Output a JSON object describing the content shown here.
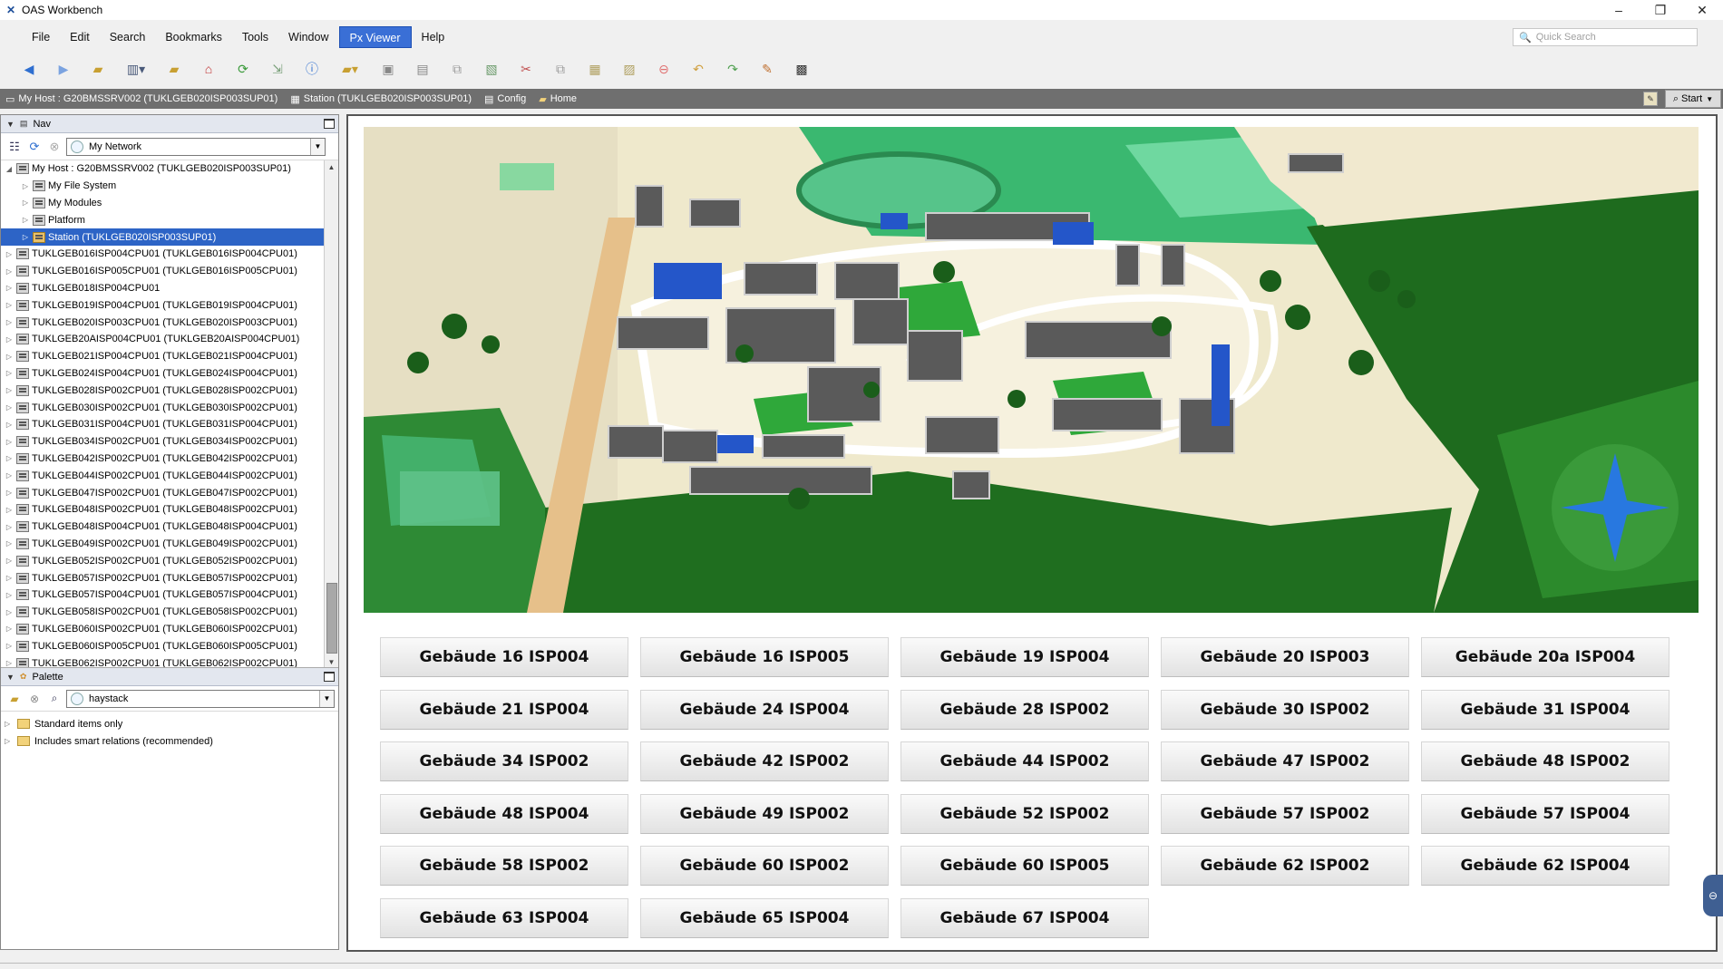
{
  "window": {
    "title": "OAS Workbench",
    "app_icon": "oas-logo-icon",
    "controls": [
      "minimize-icon",
      "restore-icon",
      "close-icon"
    ]
  },
  "menubar": {
    "items": [
      "File",
      "Edit",
      "Search",
      "Bookmarks",
      "Tools",
      "Window",
      "Px Viewer",
      "Help"
    ],
    "active": "Px Viewer",
    "quick_search_placeholder": "Quick Search"
  },
  "toolbar": {
    "icons": [
      "back-icon",
      "forward-icon",
      "open-folder-icon",
      "sidebar-toggle-icon",
      "folder-refresh-icon",
      "home-icon",
      "refresh-icon",
      "export-icon",
      "info-icon",
      "open-dropdown-icon",
      "save-icon",
      "save-all-icon",
      "copy-file-icon",
      "paste-file-icon",
      "cut-icon",
      "copy-icon",
      "paste-icon",
      "duplicate-icon",
      "delete-icon",
      "undo-icon",
      "redo-icon",
      "edit-icon",
      "snapshot-icon"
    ]
  },
  "breadcrumb": {
    "items": [
      {
        "label": "My Host : G20BMSSRV002 (TUKLGEB020ISP003SUP01)",
        "icon": "host-icon"
      },
      {
        "label": "Station (TUKLGEB020ISP003SUP01)",
        "icon": "station-icon"
      },
      {
        "label": "Config",
        "icon": "config-icon"
      },
      {
        "label": "Home",
        "icon": "folder-icon"
      }
    ],
    "start_label": "Start"
  },
  "nav": {
    "title": "Nav",
    "network_select": "My Network",
    "tree": [
      {
        "label": "My Host : G20BMSSRV002 (TUKLGEB020ISP003SUP01)",
        "level": 0,
        "expanded": true,
        "icon": "host"
      },
      {
        "label": "My File System",
        "level": 1,
        "icon": "host"
      },
      {
        "label": "My Modules",
        "level": 1,
        "icon": "host"
      },
      {
        "label": "Platform",
        "level": 1,
        "icon": "host"
      },
      {
        "label": "Station (TUKLGEB020ISP003SUP01)",
        "level": 1,
        "selected": true,
        "icon": "station"
      },
      {
        "label": "TUKLGEB016ISP004CPU01 (TUKLGEB016ISP004CPU01)",
        "level": 0,
        "icon": "host"
      },
      {
        "label": "TUKLGEB016ISP005CPU01 (TUKLGEB016ISP005CPU01)",
        "level": 0,
        "icon": "host"
      },
      {
        "label": "TUKLGEB018ISP004CPU01",
        "level": 0,
        "icon": "host"
      },
      {
        "label": "TUKLGEB019ISP004CPU01 (TUKLGEB019ISP004CPU01)",
        "level": 0,
        "icon": "host"
      },
      {
        "label": "TUKLGEB020ISP003CPU01 (TUKLGEB020ISP003CPU01)",
        "level": 0,
        "icon": "host"
      },
      {
        "label": "TUKLGEB20AISP004CPU01 (TUKLGEB20AISP004CPU01)",
        "level": 0,
        "icon": "host"
      },
      {
        "label": "TUKLGEB021ISP004CPU01 (TUKLGEB021ISP004CPU01)",
        "level": 0,
        "icon": "host"
      },
      {
        "label": "TUKLGEB024ISP004CPU01 (TUKLGEB024ISP004CPU01)",
        "level": 0,
        "icon": "host"
      },
      {
        "label": "TUKLGEB028ISP002CPU01 (TUKLGEB028ISP002CPU01)",
        "level": 0,
        "icon": "host"
      },
      {
        "label": "TUKLGEB030ISP002CPU01 (TUKLGEB030ISP002CPU01)",
        "level": 0,
        "icon": "host"
      },
      {
        "label": "TUKLGEB031ISP004CPU01 (TUKLGEB031ISP004CPU01)",
        "level": 0,
        "icon": "host"
      },
      {
        "label": "TUKLGEB034ISP002CPU01 (TUKLGEB034ISP002CPU01)",
        "level": 0,
        "icon": "host"
      },
      {
        "label": "TUKLGEB042ISP002CPU01 (TUKLGEB042ISP002CPU01)",
        "level": 0,
        "icon": "host"
      },
      {
        "label": "TUKLGEB044ISP002CPU01 (TUKLGEB044ISP002CPU01)",
        "level": 0,
        "icon": "host"
      },
      {
        "label": "TUKLGEB047ISP002CPU01 (TUKLGEB047ISP002CPU01)",
        "level": 0,
        "icon": "host"
      },
      {
        "label": "TUKLGEB048ISP002CPU01 (TUKLGEB048ISP002CPU01)",
        "level": 0,
        "icon": "host"
      },
      {
        "label": "TUKLGEB048ISP004CPU01 (TUKLGEB048ISP004CPU01)",
        "level": 0,
        "icon": "host"
      },
      {
        "label": "TUKLGEB049ISP002CPU01 (TUKLGEB049ISP002CPU01)",
        "level": 0,
        "icon": "host"
      },
      {
        "label": "TUKLGEB052ISP002CPU01 (TUKLGEB052ISP002CPU01)",
        "level": 0,
        "icon": "host"
      },
      {
        "label": "TUKLGEB057ISP002CPU01 (TUKLGEB057ISP002CPU01)",
        "level": 0,
        "icon": "host"
      },
      {
        "label": "TUKLGEB057ISP004CPU01 (TUKLGEB057ISP004CPU01)",
        "level": 0,
        "icon": "host"
      },
      {
        "label": "TUKLGEB058ISP002CPU01 (TUKLGEB058ISP002CPU01)",
        "level": 0,
        "icon": "host"
      },
      {
        "label": "TUKLGEB060ISP002CPU01 (TUKLGEB060ISP002CPU01)",
        "level": 0,
        "icon": "host"
      },
      {
        "label": "TUKLGEB060ISP005CPU01 (TUKLGEB060ISP005CPU01)",
        "level": 0,
        "icon": "host"
      },
      {
        "label": "TUKLGEB062ISP002CPU01 (TUKLGEB062ISP002CPU01)",
        "level": 0,
        "icon": "host"
      }
    ]
  },
  "palette": {
    "title": "Palette",
    "search_value": "haystack",
    "items": [
      "Standard items only",
      "Includes smart relations (recommended)"
    ]
  },
  "buildings": [
    "Gebäude 16 ISP004",
    "Gebäude 16 ISP005",
    "Gebäude 19 ISP004",
    "Gebäude 20 ISP003",
    "Gebäude 20a ISP004",
    "Gebäude 21 ISP004",
    "Gebäude 24 ISP004",
    "Gebäude 28 ISP002",
    "Gebäude 30 ISP002",
    "Gebäude 31 ISP004",
    "Gebäude 34 ISP002",
    "Gebäude 42 ISP002",
    "Gebäude 44 ISP002",
    "Gebäude 47 ISP002",
    "Gebäude 48 ISP002",
    "Gebäude 48 ISP004",
    "Gebäude 49 ISP002",
    "Gebäude 52 ISP002",
    "Gebäude 57 ISP002",
    "Gebäude 57 ISP004",
    "Gebäude 58 ISP002",
    "Gebäude 60 ISP002",
    "Gebäude 60 ISP005",
    "Gebäude 62 ISP002",
    "Gebäude 62 ISP004",
    "Gebäude 63 ISP004",
    "Gebäude 65 ISP004",
    "Gebäude 67 ISP004"
  ],
  "colors": {
    "accent": "#3a6fd6",
    "selection": "#2d64c6",
    "breadcrumb_bg": "#6f6f6f",
    "map_green": "#1f8a1f",
    "map_blue_roof": "#2456c9"
  }
}
